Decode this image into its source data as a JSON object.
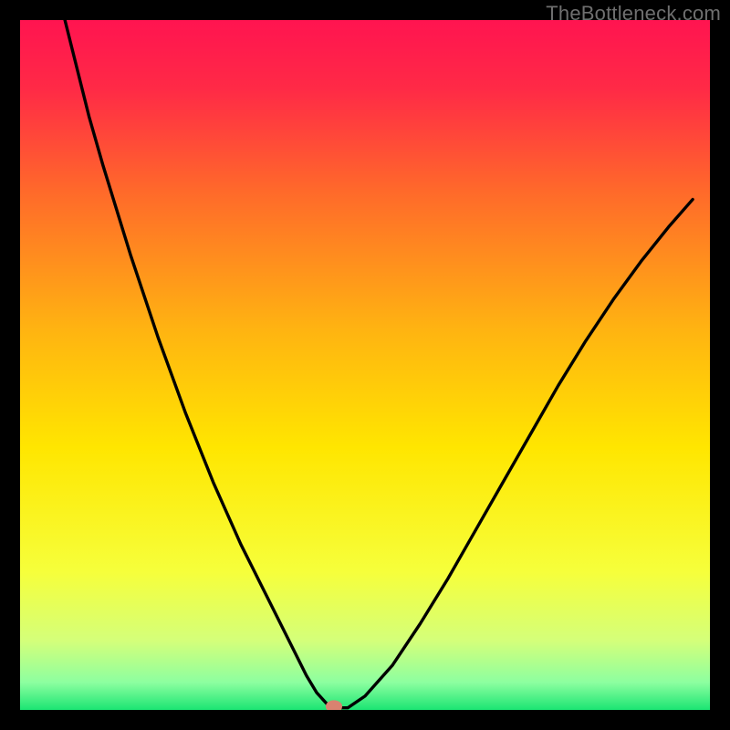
{
  "watermark": "TheBottleneck.com",
  "chart_data": {
    "type": "line",
    "title": "",
    "xlabel": "",
    "ylabel": "",
    "xlim": [
      0,
      100
    ],
    "ylim": [
      0,
      100
    ],
    "gradient_colors": {
      "top": "#ff1450",
      "mid": "#ffd500",
      "low": "#c8ff78",
      "bottom": "#1be573"
    },
    "marker": {
      "x": 45.5,
      "y": 0.5,
      "color": "#d98270",
      "rx": 1.2,
      "ry": 0.9
    },
    "x": [
      6.5,
      8,
      10,
      12,
      14,
      16,
      18,
      20,
      22,
      24,
      26,
      28,
      30,
      32,
      34,
      36,
      38,
      40,
      41.5,
      43,
      45,
      47.5,
      50,
      54,
      58,
      62,
      66,
      70,
      74,
      78,
      82,
      86,
      90,
      94,
      97.5
    ],
    "values": [
      100,
      94,
      86,
      79,
      72.5,
      66,
      60,
      54,
      48.5,
      43,
      38,
      33,
      28.5,
      24,
      20,
      16,
      12,
      8,
      5,
      2.5,
      0.3,
      0.3,
      2,
      6.5,
      12.5,
      19,
      26,
      33,
      40,
      47,
      53.5,
      59.5,
      65,
      70,
      74
    ]
  }
}
